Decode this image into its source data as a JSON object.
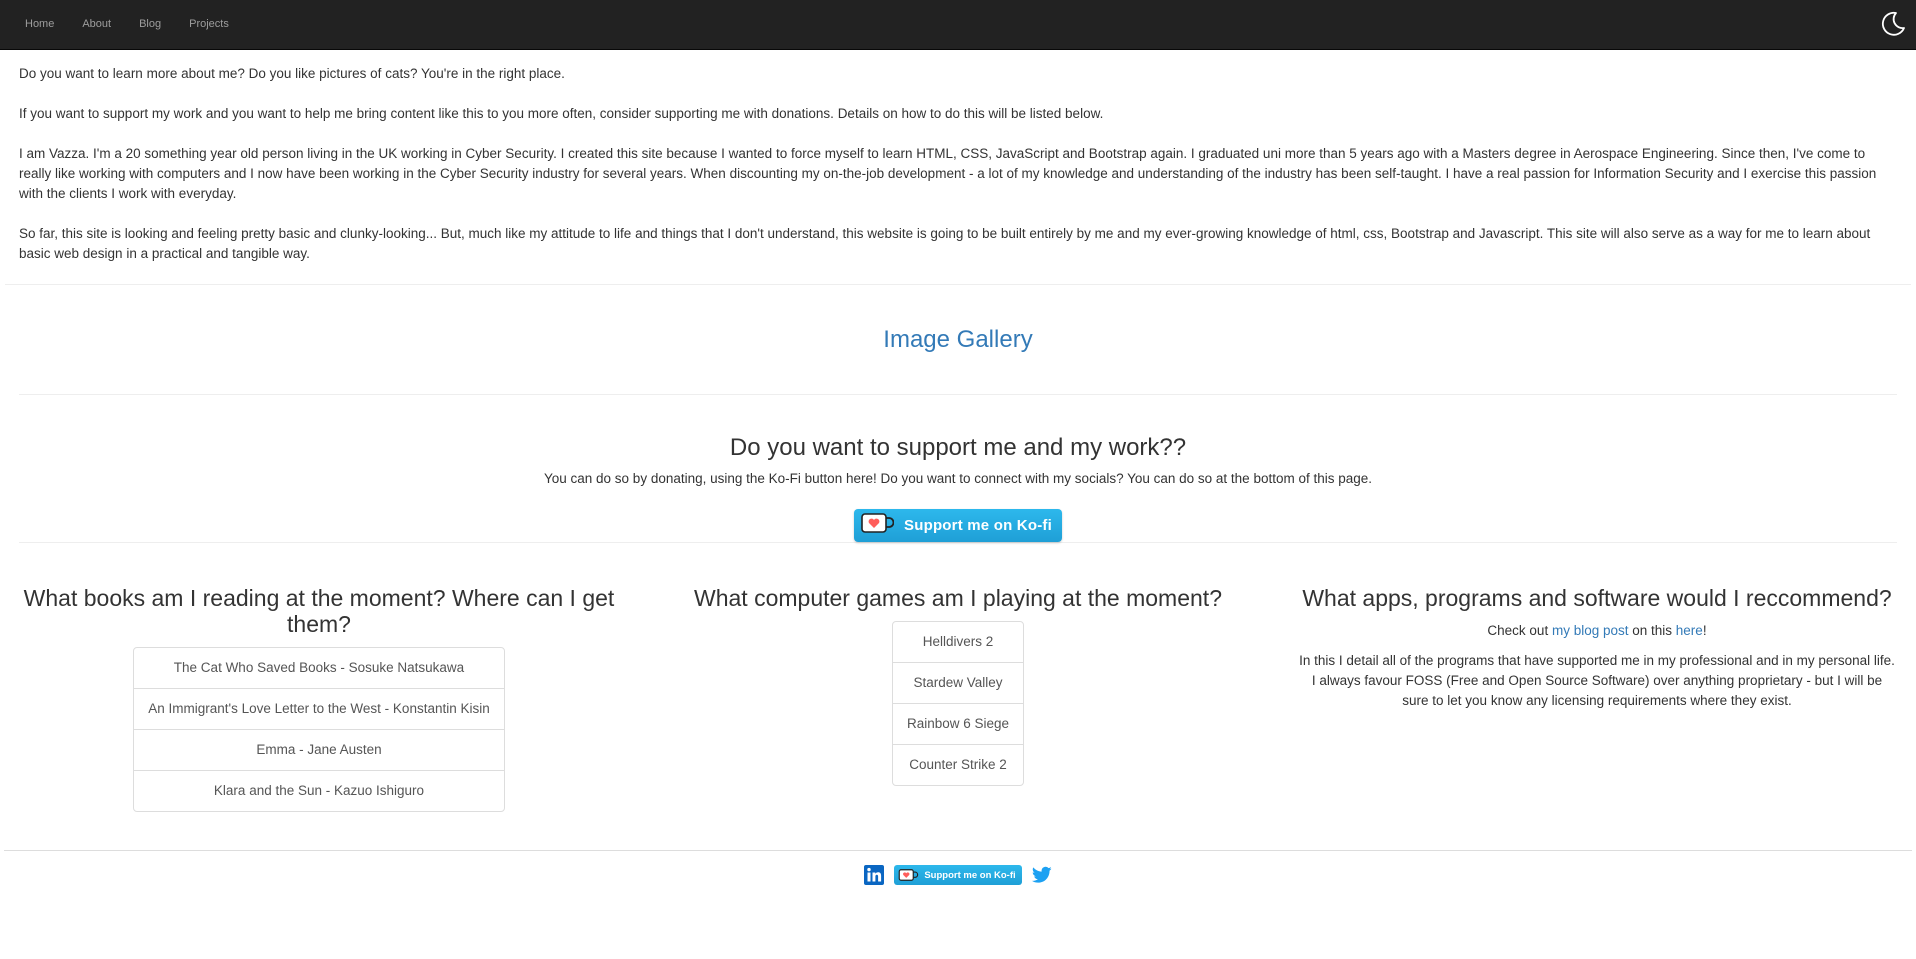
{
  "nav": {
    "items": [
      {
        "label": "Home"
      },
      {
        "label": "About"
      },
      {
        "label": "Blog"
      },
      {
        "label": "Projects"
      }
    ],
    "theme_icon": "moon-icon"
  },
  "intro": {
    "p1": "Do you want to learn more about me? Do you like pictures of cats? You're in the right place.",
    "p2": "If you want to support my work and you want to help me bring content like this to you more often, consider supporting me with donations. Details on how to do this will be listed below.",
    "p3": "I am Vazza. I'm a 20 something year old person living in the UK working in Cyber Security. I created this site because I wanted to force myself to learn HTML, CSS, JavaScript and Bootstrap again. I graduated uni more than 5 years ago with a Masters degree in Aerospace Engineering. Since then, I've come to really like working with computers and I now have been working in the Cyber Security industry for several years. When discounting my on-the-job development - a lot of my knowledge and understanding of the industry has been self-taught. I have a real passion for Information Security and I exercise this passion with the clients I work with everyday.",
    "p4": "So far, this site is looking and feeling pretty basic and clunky-looking... But, much like my attitude to life and things that I don't understand, this website is going to be built entirely by me and my ever-growing knowledge of html, css, Bootstrap and Javascript. This site will also serve as a way for me to learn about basic web design in a practical and tangible way."
  },
  "gallery": {
    "label": "Image Gallery"
  },
  "support": {
    "heading": "Do you want to support me and my work??",
    "text": "You can do so by donating, using the Ko-Fi button here! Do you want to connect with my socials? You can do so at the bottom of this page.",
    "kofi_label": "Support me on Ko-fi"
  },
  "books": {
    "heading": "What books am I reading at the moment? Where can I get them?",
    "items": [
      "The Cat Who Saved Books - Sosuke Natsukawa",
      "An Immigrant's Love Letter to the West - Konstantin Kisin",
      "Emma - Jane Austen",
      "Klara and the Sun - Kazuo Ishiguro"
    ]
  },
  "games": {
    "heading": "What computer games am I playing at the moment?",
    "items": [
      "Helldivers 2",
      "Stardew Valley",
      "Rainbow 6 Siege",
      "Counter Strike 2"
    ]
  },
  "apps": {
    "heading": "What apps, programs and software would I reccommend?",
    "check_prefix": "Check out ",
    "blog_link": "my blog post",
    "check_middle": " on this ",
    "here_link": "here",
    "check_suffix": "!",
    "detail": "In this I detail all of the programs that have supported me in my professional and in my personal life. I always favour FOSS (Free and Open Source Software) over anything proprietary - but I will be sure to let you know any licensing requirements where they exist."
  },
  "footer": {
    "kofi_label": "Support me on Ko-fi",
    "linkedin_icon": "linkedin-icon",
    "twitter_icon": "twitter-icon"
  },
  "colors": {
    "navbar": "#222222",
    "link": "#337ab7",
    "kofi": "#29abe0",
    "heart": "#ff5e5b",
    "twitter": "#1da1f2",
    "linkedin": "#0a66c2"
  }
}
